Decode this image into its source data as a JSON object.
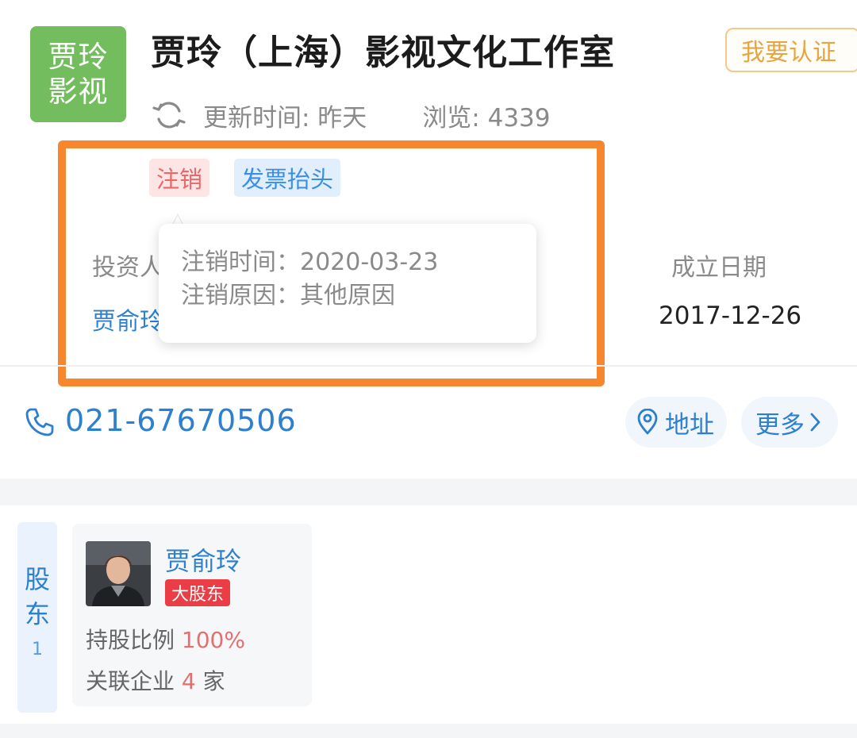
{
  "company": {
    "logo_line1": "贾玲",
    "logo_line2": "影视",
    "title": "贾玲（上海）影视文化工作室",
    "certify_label": "我要认证",
    "updated_text": "更新时间: 昨天",
    "views_text": "浏览: 4339"
  },
  "status": {
    "tag_cancel": "注销",
    "tag_invoice": "发票抬头",
    "investor_label": "投资人",
    "investor_name": "贾俞玲",
    "founded_label": "成立日期",
    "founded_date": "2017-12-26"
  },
  "tooltip": {
    "cancel_time": "注销时间：2020-03-23",
    "cancel_reason": "注销原因：其他原因"
  },
  "contact": {
    "phone": "021-67670506",
    "address_label": "地址",
    "more_label": "更多"
  },
  "shareholder": {
    "section_label": "股东",
    "count": "1",
    "name": "贾俞玲",
    "badge": "大股东",
    "ratio_label": "持股比例",
    "ratio_value": "100%",
    "related_label": "关联企业",
    "related_count": "4",
    "related_unit": "家"
  },
  "colors": {
    "brand_green": "#73bd5f",
    "highlight_orange": "#f6872f",
    "link_blue": "#2d7fd0",
    "cancel_red": "#ea6868",
    "badge_red": "#ea3d46",
    "certify_gold": "#e7a540"
  },
  "icons": {
    "refresh": "refresh-icon",
    "phone": "phone-icon",
    "location": "location-pin-icon",
    "chevron": "chevron-right-icon"
  }
}
